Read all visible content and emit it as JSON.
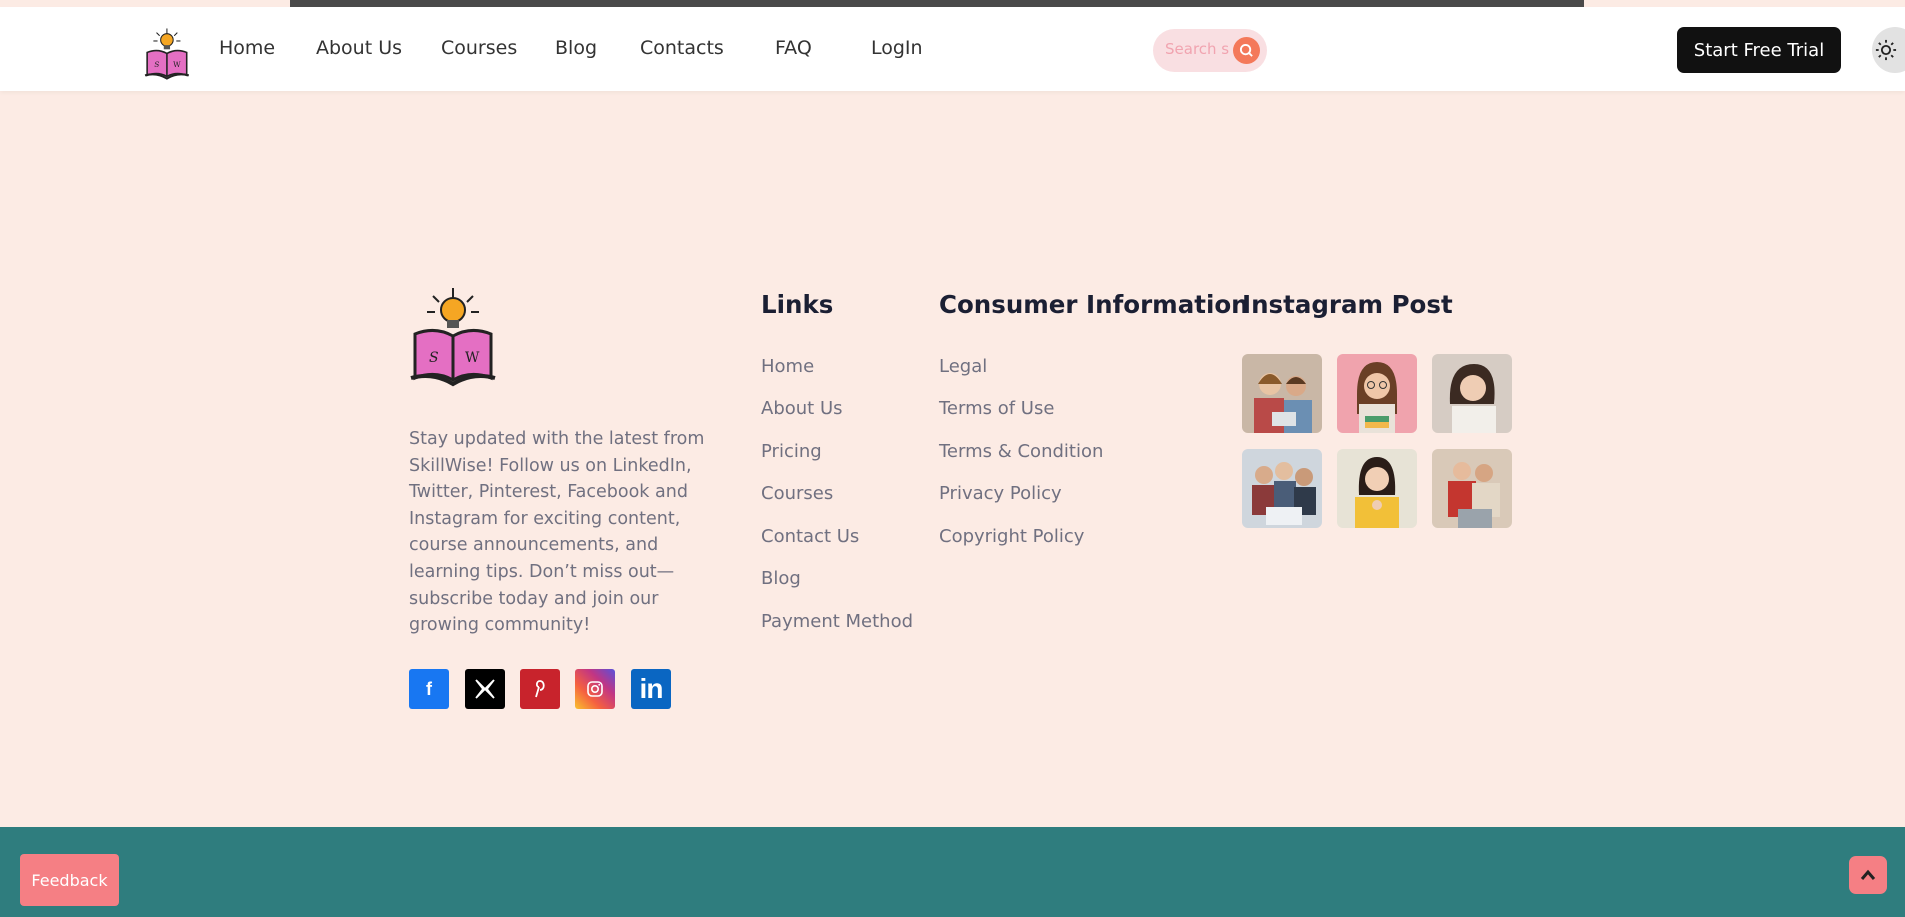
{
  "nav": {
    "items": [
      {
        "label": "Home"
      },
      {
        "label": "About Us"
      },
      {
        "label": "Courses"
      },
      {
        "label": "Blog"
      },
      {
        "label": "Contacts"
      },
      {
        "label": "FAQ"
      },
      {
        "label": "LogIn"
      }
    ],
    "search_placeholder": "Search s",
    "cta_label": "Start Free Trial"
  },
  "footer": {
    "logo_letters": [
      "S",
      "W"
    ],
    "about_text": "Stay updated with the latest from SkillWise! Follow us on LinkedIn, Twitter, Pinterest, Facebook and Instagram for exciting content, course announcements, and learning tips. Don’t miss out—subscribe today and join our growing community!",
    "socials": [
      {
        "icon": "facebook-icon",
        "glyph": "f",
        "color": "#1877f2"
      },
      {
        "icon": "x-twitter-icon",
        "glyph": "𝕏",
        "color": "#000000"
      },
      {
        "icon": "pinterest-icon",
        "glyph": "P",
        "color": "#c8232c"
      },
      {
        "icon": "instagram-icon",
        "glyph": "",
        "color": "#e1306c"
      },
      {
        "icon": "linkedin-icon",
        "glyph": "in",
        "color": "#0a66c2"
      }
    ],
    "links": {
      "title": "Links",
      "items": [
        "Home",
        "About Us",
        "Pricing",
        "Courses",
        "Contact Us",
        "Blog",
        "Payment Method"
      ]
    },
    "consumer": {
      "title": "Consumer Information",
      "items": [
        "Legal",
        "Terms of Use",
        "Terms & Condition",
        "Privacy Policy",
        "Copyright Policy"
      ]
    },
    "instagram": {
      "title": "Instagram Post"
    }
  },
  "feedback_label": "Feedback",
  "colors": {
    "page_bg": "#fcebe4",
    "footer_band": "#2f7d7e",
    "accent": "#f57f84",
    "cta_bg": "#111111"
  }
}
